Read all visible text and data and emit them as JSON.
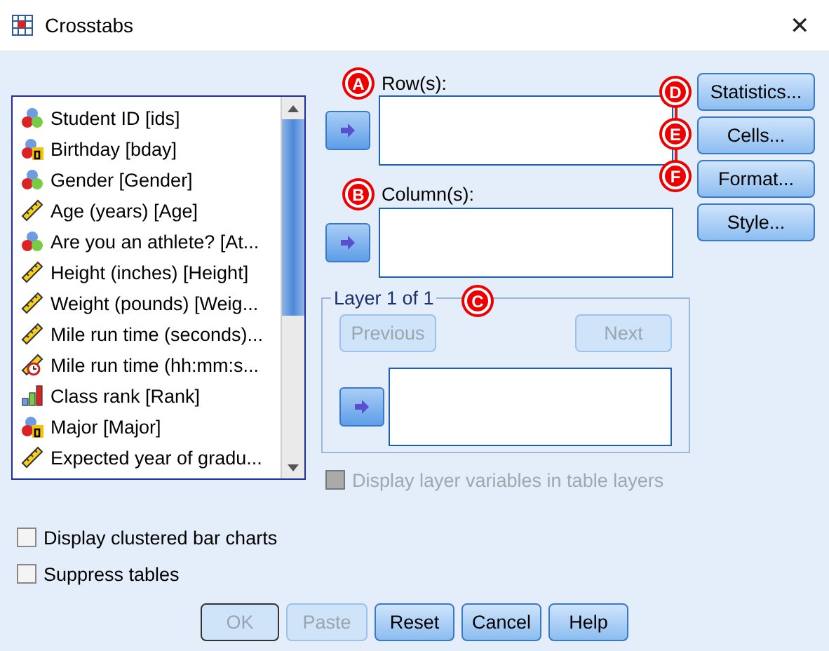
{
  "window": {
    "title": "Crosstabs",
    "close": "✕"
  },
  "variables": [
    {
      "label": "Student ID [ids]",
      "kind": "nominal",
      "selected": false
    },
    {
      "label": "Birthday [bday]",
      "kind": "nominal_string",
      "selected": false
    },
    {
      "label": "Gender [Gender]",
      "kind": "nominal",
      "selected": false
    },
    {
      "label": "Age (years) [Age]",
      "kind": "scale",
      "selected": false
    },
    {
      "label": "Are you an athlete? [At...",
      "kind": "nominal",
      "selected": false
    },
    {
      "label": "Height (inches) [Height]",
      "kind": "scale",
      "selected": false
    },
    {
      "label": "Weight (pounds) [Weig...",
      "kind": "scale",
      "selected": false
    },
    {
      "label": "Mile run time (seconds)...",
      "kind": "scale",
      "selected": false
    },
    {
      "label": "Mile run time (hh:mm:s...",
      "kind": "scale_time",
      "selected": false
    },
    {
      "label": "Class rank [Rank]",
      "kind": "ordinal",
      "selected": false
    },
    {
      "label": "Major [Major]",
      "kind": "nominal_string",
      "selected": false
    },
    {
      "label": "Expected year of gradu...",
      "kind": "scale",
      "selected": false
    }
  ],
  "rows_field": {
    "label": "Row(s):"
  },
  "columns_field": {
    "label": "Column(s):"
  },
  "layer": {
    "legend": "Layer 1 of 1",
    "previous": {
      "label": "Previous",
      "disabled": true
    },
    "next": {
      "label": "Next",
      "disabled": true
    }
  },
  "display_layer_variables": {
    "label": "Display layer variables in table layers",
    "checked": false,
    "disabled": true
  },
  "side_buttons": [
    "Statistics...",
    "Cells...",
    "Format...",
    "Style..."
  ],
  "options": [
    {
      "label": "Display clustered bar charts",
      "checked": false
    },
    {
      "label": "Suppress tables",
      "checked": false
    }
  ],
  "buttons": [
    {
      "label": "OK",
      "disabled": true
    },
    {
      "label": "Paste",
      "disabled": true
    },
    {
      "label": "Reset",
      "disabled": false
    },
    {
      "label": "Cancel",
      "disabled": false
    },
    {
      "label": "Help",
      "disabled": false
    }
  ],
  "callouts": [
    "A",
    "B",
    "C",
    "D",
    "E",
    "F"
  ]
}
